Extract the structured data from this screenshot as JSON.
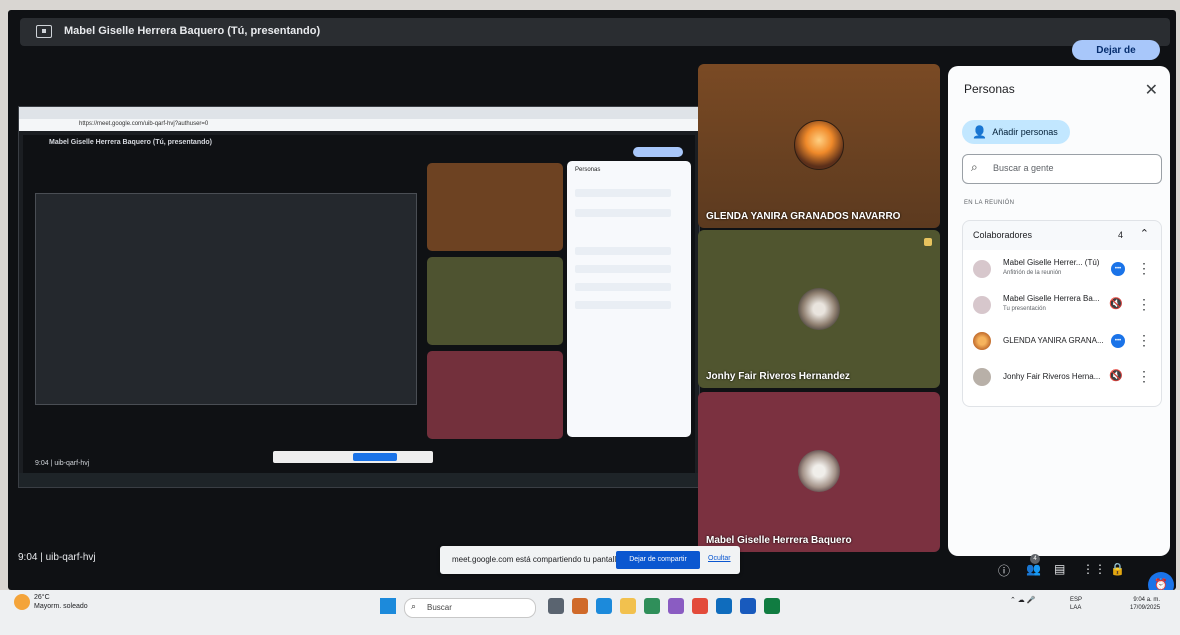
{
  "header": {
    "title": "Mabel Giselle Herrera Baquero (Tú, presentando)",
    "stop_presenting": "Dejar de presentar"
  },
  "participants": [
    {
      "name": "GLENDA YANIRA GRANADOS NAVARRO"
    },
    {
      "name": "Jonhy Fair Riveros Hernandez"
    },
    {
      "name": "Mabel Giselle Herrera Baquero"
    }
  ],
  "people_panel": {
    "title": "Personas",
    "add_people": "Añadir personas",
    "search_placeholder": "Buscar a gente",
    "section_label": "EN LA REUNIÓN",
    "group_title": "Colaboradores",
    "group_count": "4",
    "rows": [
      {
        "name": "Mabel Giselle Herrer...  (Tú)",
        "subtitle": "Anfitrión de la reunión"
      },
      {
        "name": "Mabel Giselle Herrera Ba...",
        "subtitle": "Tu presentación"
      },
      {
        "name": "GLENDA YANIRA GRANA...",
        "subtitle": ""
      },
      {
        "name": "Jonhy Fair Riveros Herna...",
        "subtitle": ""
      }
    ]
  },
  "footer": {
    "time_code": "9:04  |  uib-qarf-hvj",
    "share_notice": "meet.google.com está compartiendo tu pantalla.",
    "stop_sharing": "Dejar de compartir",
    "hide": "Ocultar",
    "people_badge": "4"
  },
  "taskbar": {
    "weather_temp": "26°C",
    "weather_desc": "Mayorm. soleado",
    "search_text": "Buscar",
    "lang_line1": "ESP",
    "lang_line2": "LAA",
    "time": "9:04 a. m.",
    "date": "17/09/2025"
  },
  "nested": {
    "title": "Mabel Giselle Herrera Baquero (Tú, presentando)",
    "url": "https://meet.google.com/uib-qarf-hvj?authuser=0",
    "code": "9:04  |  uib-qarf-hvj"
  },
  "icons": [
    "present-icon",
    "close-icon",
    "add-person-icon",
    "search-icon",
    "chevron-up-icon",
    "more-vert-icon",
    "mic-off-icon",
    "info-icon",
    "people-icon",
    "chat-icon",
    "apps-icon",
    "lock-icon",
    "host-icon",
    "windows-icon"
  ]
}
